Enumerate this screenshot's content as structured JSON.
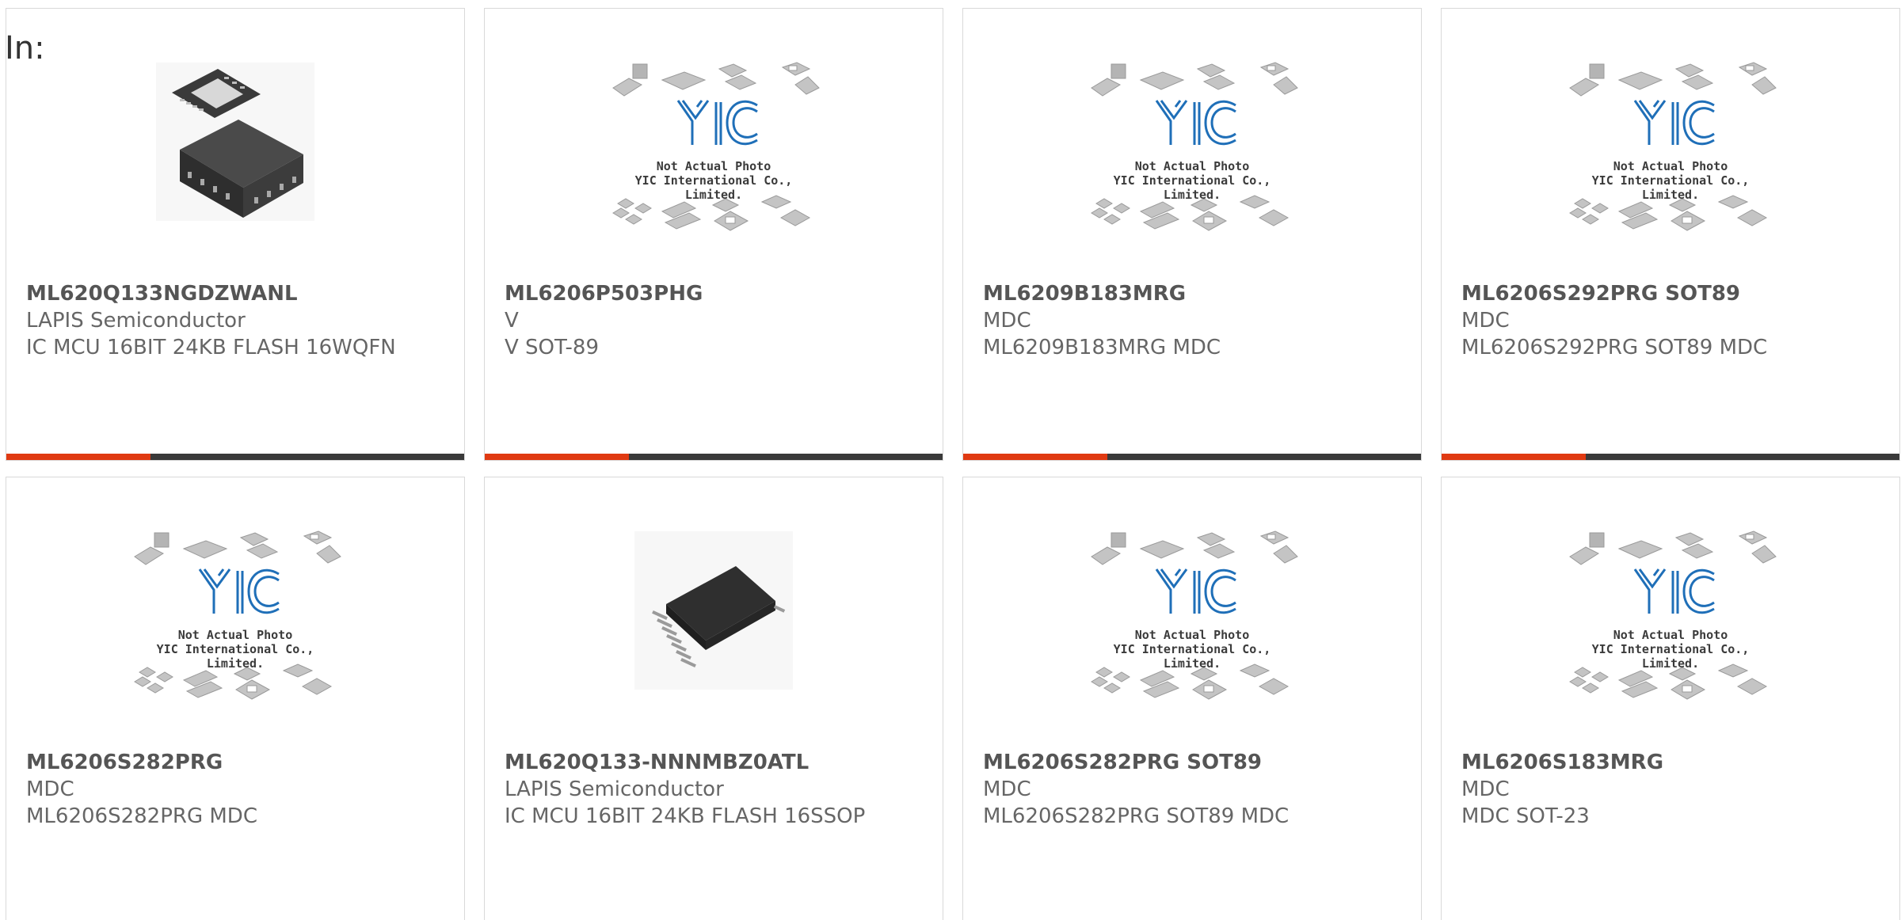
{
  "header": {
    "in_label": "In:"
  },
  "placeholder": {
    "logo_text": "YIC",
    "caption_line1": "Not Actual Photo",
    "caption_line2": "YIC International Co., Limited."
  },
  "colors": {
    "accent": "#e03a12",
    "bar": "#3a3a3a",
    "logo_blue": "#1f6fb8"
  },
  "products": [
    {
      "part": "ML620Q133NGDZWANL",
      "line1": "LAPIS Semiconductor",
      "line2": "IC MCU 16BIT 24KB FLASH 16WQFN",
      "image": "qfn-chip-photo"
    },
    {
      "part": "ML6206P503PHG",
      "line1": "V",
      "line2": "V SOT-89",
      "image": "not-actual-photo"
    },
    {
      "part": "ML6209B183MRG",
      "line1": "MDC",
      "line2": "ML6209B183MRG MDC",
      "image": "not-actual-photo"
    },
    {
      "part": "ML6206S292PRG SOT89",
      "line1": "MDC",
      "line2": "ML6206S292PRG SOT89 MDC",
      "image": "not-actual-photo"
    },
    {
      "part": "ML6206S282PRG",
      "line1": "MDC",
      "line2": "ML6206S282PRG MDC",
      "image": "not-actual-photo"
    },
    {
      "part": "ML620Q133-NNNMBZ0ATL",
      "line1": "LAPIS Semiconductor",
      "line2": "IC MCU 16BIT 24KB FLASH 16SSOP",
      "image": "ssop-chip-photo"
    },
    {
      "part": "ML6206S282PRG SOT89",
      "line1": "MDC",
      "line2": "ML6206S282PRG SOT89 MDC",
      "image": "not-actual-photo"
    },
    {
      "part": "ML6206S183MRG",
      "line1": "MDC",
      "line2": "MDC SOT-23",
      "image": "not-actual-photo"
    }
  ]
}
